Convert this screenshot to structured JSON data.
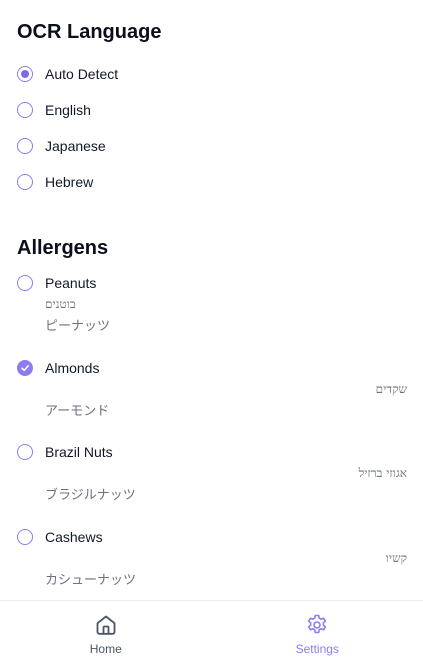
{
  "ocr": {
    "title": "OCR Language",
    "options": [
      {
        "label": "Auto Detect",
        "selected": true
      },
      {
        "label": "English",
        "selected": false
      },
      {
        "label": "Japanese",
        "selected": false
      },
      {
        "label": "Hebrew",
        "selected": false
      }
    ]
  },
  "allergens": {
    "title": "Allergens",
    "items": [
      {
        "name": "Peanuts",
        "hebrew": "בוטנים",
        "japanese": "ピーナッツ",
        "checked": false
      },
      {
        "name": "Almonds",
        "hebrew": "שקדים",
        "japanese": "アーモンド",
        "checked": true
      },
      {
        "name": "Brazil Nuts",
        "hebrew": "אגוזי ברזיל",
        "japanese": "ブラジルナッツ",
        "checked": false
      },
      {
        "name": "Cashews",
        "hebrew": "קשיו",
        "japanese": "カシューナッツ",
        "checked": false
      }
    ]
  },
  "nav": {
    "home_label": "Home",
    "home_icon": "home-icon",
    "settings_label": "Settings",
    "settings_icon": "gear-icon",
    "active": "settings"
  },
  "colors": {
    "accent": "#8b7cf0",
    "text": "#111827",
    "muted": "#6b7280"
  }
}
